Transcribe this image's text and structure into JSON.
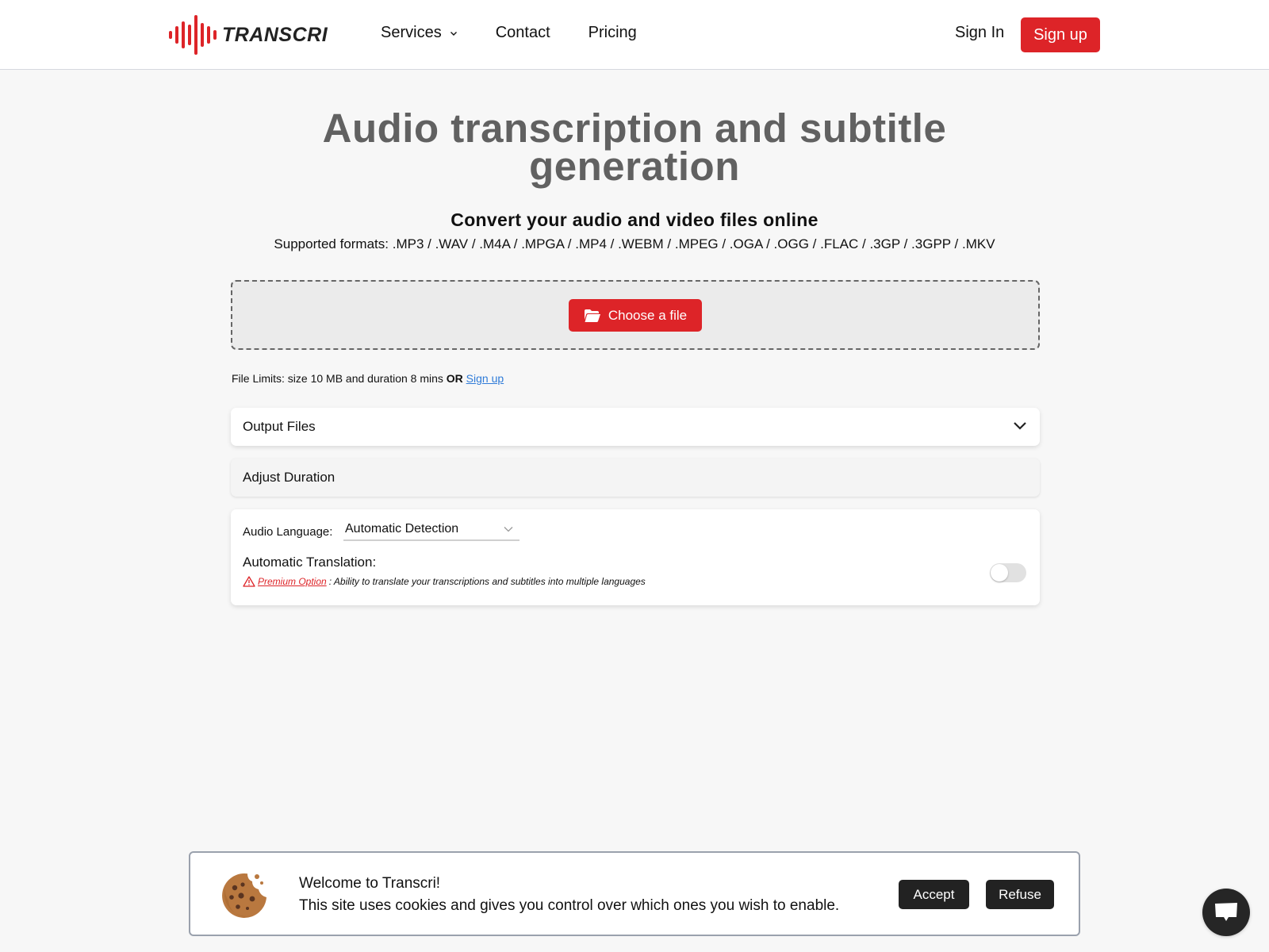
{
  "header": {
    "brand": "TRANSCRI",
    "nav": [
      {
        "label": "Services",
        "has_dropdown": true
      },
      {
        "label": "Contact"
      },
      {
        "label": "Pricing"
      }
    ],
    "sign_in": "Sign In",
    "sign_up": "Sign up"
  },
  "hero": {
    "title": "Audio transcription and subtitle generation",
    "subtitle": "Convert your audio and video files online",
    "formats": "Supported formats: .MP3 / .WAV / .M4A / .MPGA / .MP4 / .WEBM / .MPEG / .OGA / .OGG / .FLAC / .3GP / .3GPP / .MKV"
  },
  "upload": {
    "button_label": "Choose a file",
    "icon": "folder-open-icon"
  },
  "limits": {
    "text": "File Limits: size 10 MB and duration 8 mins",
    "or": "OR",
    "link": "Sign up"
  },
  "panels": {
    "output_files": "Output Files",
    "adjust_duration": "Adjust Duration"
  },
  "language": {
    "label": "Audio Language:",
    "selected": "Automatic Detection",
    "translation_label": "Automatic Translation:",
    "premium_link": "Premium Option",
    "premium_text": ": Ability to translate your transcriptions and subtitles into multiple languages",
    "translation_enabled": false
  },
  "cookie": {
    "title": "Welcome to Transcri!",
    "text": "This site uses cookies and gives you control over which ones you wish to enable.",
    "accept": "Accept",
    "refuse": "Refuse"
  },
  "colors": {
    "brand_red": "#dd2428",
    "link_blue": "#2f7bd8",
    "dark_button": "#222222",
    "title_gray": "#616161"
  }
}
